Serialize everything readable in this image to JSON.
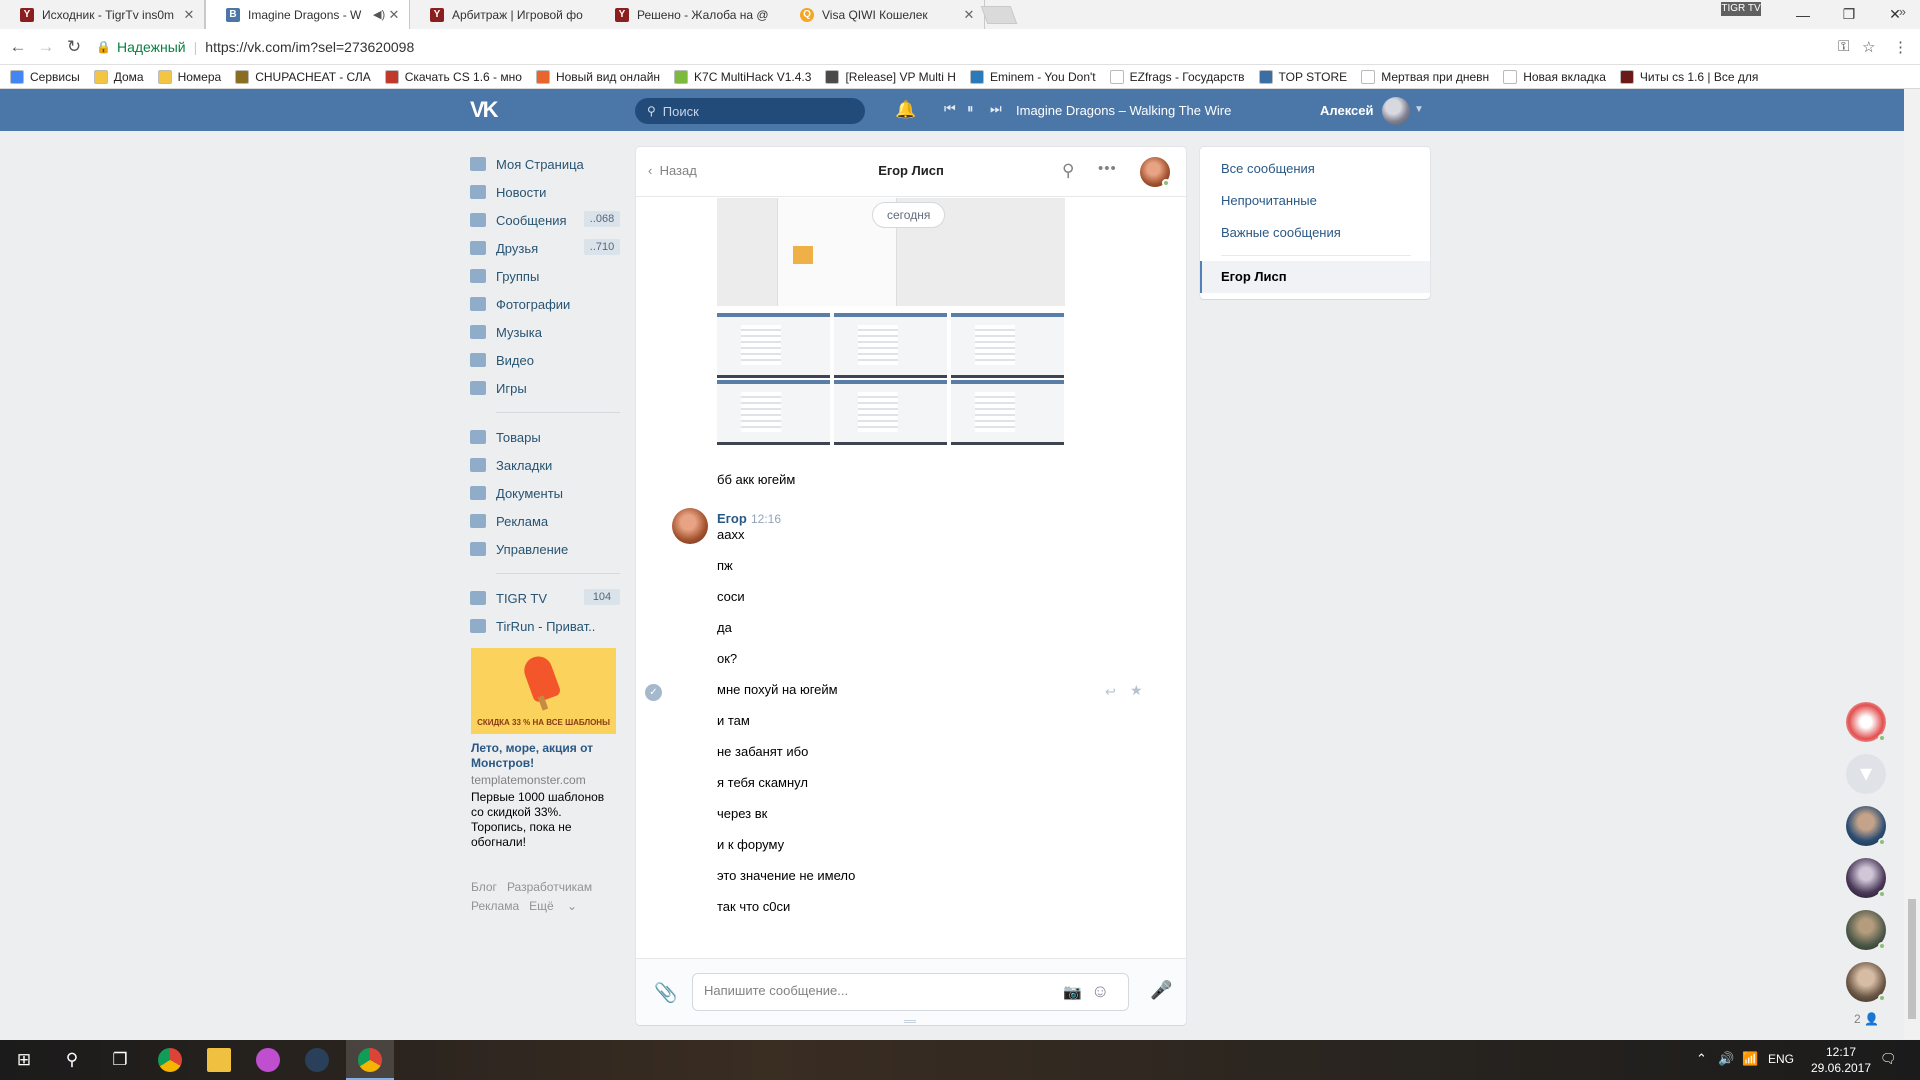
{
  "browser": {
    "tabs": [
      {
        "title": "Исходник - TigrTv ins0m",
        "favicon_color": "#8b1e1e",
        "favicon_letter": "Y"
      },
      {
        "title": "Imagine Dragons - W",
        "favicon_color": "#4a76a8",
        "favicon_letter": "B"
      },
      {
        "title": "Арбитраж | Игровой фо",
        "favicon_color": "#8b1e1e",
        "favicon_letter": "Y"
      },
      {
        "title": "Решено - Жалоба на @",
        "favicon_color": "#8b1e1e",
        "favicon_letter": "Y"
      },
      {
        "title": "Visa QIWI Кошелек",
        "favicon_color": "#f5a623",
        "favicon_letter": "Q"
      }
    ],
    "active_tab_index": 1,
    "profile_badge": "TIGR TV",
    "address": {
      "secure_label": "Надежный",
      "url": "https://vk.com/im?sel=273620098"
    },
    "bookmarks": [
      {
        "label": "Сервисы",
        "color": "#4285f4"
      },
      {
        "label": "Дома",
        "color": "#f4c542"
      },
      {
        "label": "Номера",
        "color": "#f4c542"
      },
      {
        "label": "CHUPACHEAT - СЛА",
        "color": "#8a6d1e"
      },
      {
        "label": "Скачать CS 1.6 - мно",
        "color": "#c0392b"
      },
      {
        "label": "Новый вид онлайн",
        "color": "#e8662c"
      },
      {
        "label": "K7C MultiHack V1.4.3",
        "color": "#7cbb3a"
      },
      {
        "label": "[Release] VP Multi H",
        "color": "#4a4a4a"
      },
      {
        "label": "Eminem - You Don't",
        "color": "#2a7ab9"
      },
      {
        "label": "EZfrags - Государств",
        "color": "#ffffff"
      },
      {
        "label": "TOP STORE",
        "color": "#3a6ea5"
      },
      {
        "label": "Мертвая при дневн",
        "color": "#ffffff"
      },
      {
        "label": "Новая вкладка",
        "color": "#ffffff"
      },
      {
        "label": "Читы cs 1.6 | Все для",
        "color": "#6b1a1a"
      }
    ]
  },
  "vk": {
    "search_placeholder": "Поиск",
    "now_playing": "Imagine Dragons – Walking The Wire",
    "user_name": "Алексей",
    "menu": [
      {
        "label": "Моя Страница",
        "badge": ""
      },
      {
        "label": "Новости",
        "badge": ""
      },
      {
        "label": "Сообщения",
        "badge": "..068"
      },
      {
        "label": "Друзья",
        "badge": "..710"
      },
      {
        "label": "Группы",
        "badge": ""
      },
      {
        "label": "Фотографии",
        "badge": ""
      },
      {
        "label": "Музыка",
        "badge": ""
      },
      {
        "label": "Видео",
        "badge": ""
      },
      {
        "label": "Игры",
        "badge": ""
      }
    ],
    "menu2": [
      {
        "label": "Товары"
      },
      {
        "label": "Закладки"
      },
      {
        "label": "Документы"
      },
      {
        "label": "Реклама"
      },
      {
        "label": "Управление"
      }
    ],
    "menu3": [
      {
        "label": "TIGR TV",
        "badge": "104"
      },
      {
        "label": "TirRun - Приват..",
        "badge": ""
      }
    ],
    "ad": {
      "image_text": "СКИДКА 33 % НА ВСЕ ШАБЛОНЫ",
      "title": "Лето, море, акция от Монстров!",
      "domain": "templatemonster.com",
      "description": "Первые 1000 шаблонов со скидкой 33%. Торопись, пока не обогнали!"
    },
    "footer_links": [
      "Блог",
      "Разработчикам",
      "Реклама",
      "Ещё"
    ],
    "chat": {
      "back_label": "Назад",
      "title": "Егор Лисп",
      "date_label": "сегодня",
      "prev_message": "бб акк югейм",
      "sender": "Егор",
      "time": "12:16",
      "messages": [
        "аахх",
        "пж",
        "соси",
        "да",
        "ок?",
        "мне похуй на югейм",
        "и там",
        "не забанят ибо",
        "я тебя скамнул",
        "через вк",
        "и к форуму",
        "это значение не имело",
        "так что с0си"
      ],
      "input_placeholder": "Напишите сообщение..."
    },
    "right_panel": {
      "items": [
        "Все сообщения",
        "Непрочитанные",
        "Важные сообщения"
      ],
      "active": "Егор Лисп"
    },
    "friends_online_count": "2"
  },
  "taskbar": {
    "time": "12:17",
    "date": "29.06.2017",
    "lang": "ENG"
  },
  "colors": {
    "vk_header": "#4a76a8",
    "link": "#2a5885",
    "online": "#8ac176"
  }
}
